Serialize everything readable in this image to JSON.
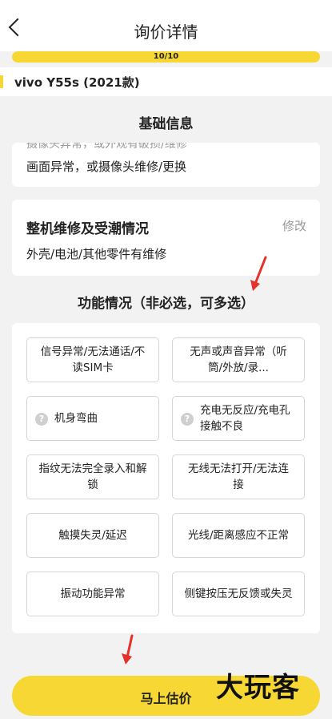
{
  "nav": {
    "title": "询价详情",
    "back_icon": "chevron-left-icon"
  },
  "progress": {
    "text": "10/10",
    "fraction": 1.0,
    "color": "#f7d733"
  },
  "model": {
    "name": "vivo Y55s (2021款)"
  },
  "basic_info": {
    "heading": "基础信息",
    "faded_line": "摄像头异常，或外观有破损/维修",
    "line": "画面异常，或摄像头维修/更换"
  },
  "repair": {
    "title": "整机维修及受潮情况",
    "edit_label": "修改",
    "detail": "外壳/电池/其他零件有维修"
  },
  "function": {
    "heading": "功能情况（非必选，可多选）",
    "options": [
      {
        "label": "信号异常/无法通话/不读SIM卡",
        "help": false
      },
      {
        "label": "无声或声音异常（听筒/外放/录...",
        "help": false
      },
      {
        "label": "机身弯曲",
        "help": true
      },
      {
        "label": "充电无反应/充电孔接触不良",
        "help": true
      },
      {
        "label": "指纹无法完全录入和解锁",
        "help": false
      },
      {
        "label": "无线无法打开/无法连接",
        "help": false
      },
      {
        "label": "触摸失灵/延迟",
        "help": false
      },
      {
        "label": "光线/距离感应不正常",
        "help": false
      },
      {
        "label": "振动功能异常",
        "help": false
      },
      {
        "label": "侧键按压无反馈或失灵",
        "help": false
      }
    ]
  },
  "bottom": {
    "button_label": "马上估价",
    "watermark": "大玩客"
  },
  "colors": {
    "accent": "#f7d733",
    "annotation_arrow": "#e5312b"
  }
}
